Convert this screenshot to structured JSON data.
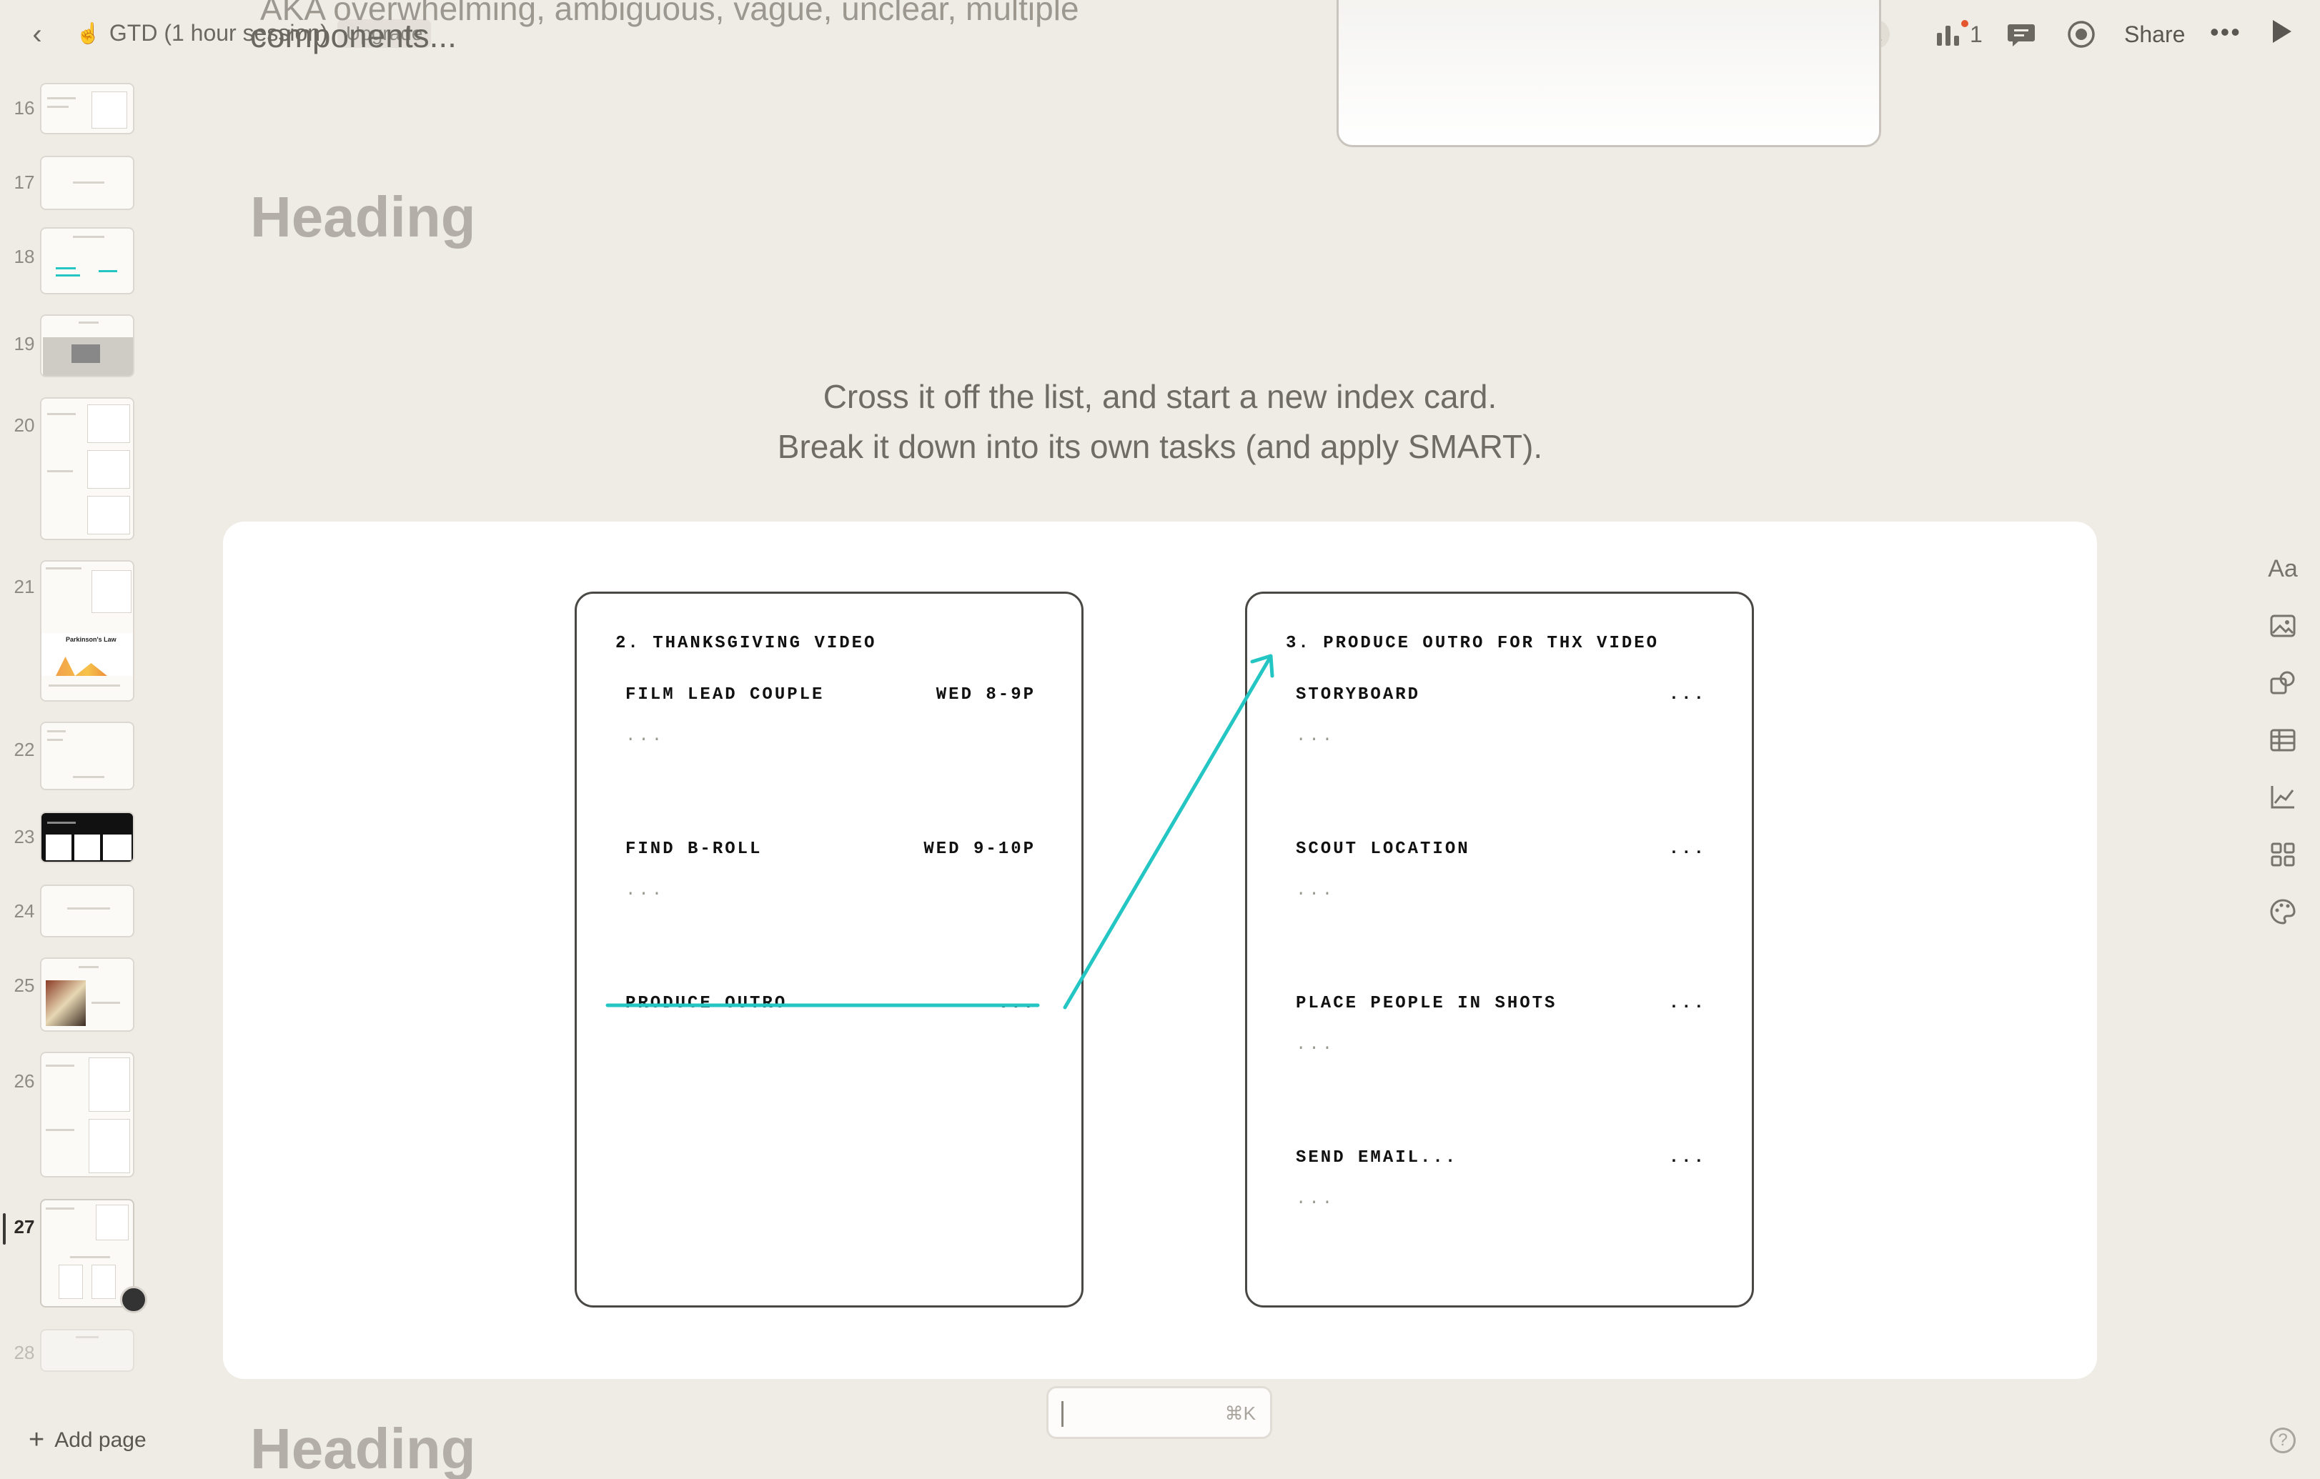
{
  "header": {
    "back_icon": "‹",
    "doc_emoji": "☝",
    "doc_title": "GTD (1 hour session)",
    "upgrade_label": "Upgrade",
    "collaborators_count": "+1",
    "analytics_count": "1",
    "share_label": "Share",
    "more_label": "•••"
  },
  "sidebar": {
    "pages": [
      {
        "num": "16"
      },
      {
        "num": "17"
      },
      {
        "num": "18"
      },
      {
        "num": "19"
      },
      {
        "num": "20"
      },
      {
        "num": "21"
      },
      {
        "num": "22"
      },
      {
        "num": "23"
      },
      {
        "num": "24"
      },
      {
        "num": "25"
      },
      {
        "num": "26"
      },
      {
        "num": "27"
      },
      {
        "num": "28"
      }
    ],
    "active_page": "27",
    "add_page_label": "Add page",
    "thumb_21_title": "Parkinson's Law"
  },
  "content": {
    "ghost_line_1": "AKA overwhelming, ambiguous, vague, unclear, multiple",
    "ghost_line_2": "components...",
    "heading_1": "Heading",
    "heading_2": "Heading",
    "caption_line_1": "Cross it off the list, and start a new index card.",
    "caption_line_2": "Break it down into its own tasks (and apply SMART)."
  },
  "left_card": {
    "title": "2. THANKSGIVING VIDEO",
    "tasks": [
      {
        "name": "FILM LEAD COUPLE",
        "when": "WED 8-9P",
        "note": "..."
      },
      {
        "name": "FIND B-ROLL",
        "when": "WED 9-10P",
        "note": "..."
      },
      {
        "name": "PRODUCE OUTRO",
        "when": "...",
        "note": ""
      }
    ]
  },
  "right_card": {
    "title": "3. PRODUCE OUTRO FOR THX VIDEO",
    "tasks": [
      {
        "name": "STORYBOARD",
        "when": "...",
        "note": "..."
      },
      {
        "name": "SCOUT LOCATION",
        "when": "...",
        "note": "..."
      },
      {
        "name": "PLACE PEOPLE IN SHOTS",
        "when": "...",
        "note": "..."
      },
      {
        "name": "SEND EMAIL...",
        "when": "...",
        "note": "..."
      }
    ]
  },
  "tools": {
    "text_tool_label": "Aa",
    "icons": [
      "text-icon",
      "image-icon",
      "shapes-icon",
      "table-icon",
      "chart-icon",
      "apps-icon",
      "palette-icon"
    ]
  },
  "command": {
    "shortcut": "⌘K"
  },
  "help_label": "?",
  "colors": {
    "background": "#efece6",
    "accent_teal": "#24c6c4",
    "notification_dot": "#e4572e"
  }
}
